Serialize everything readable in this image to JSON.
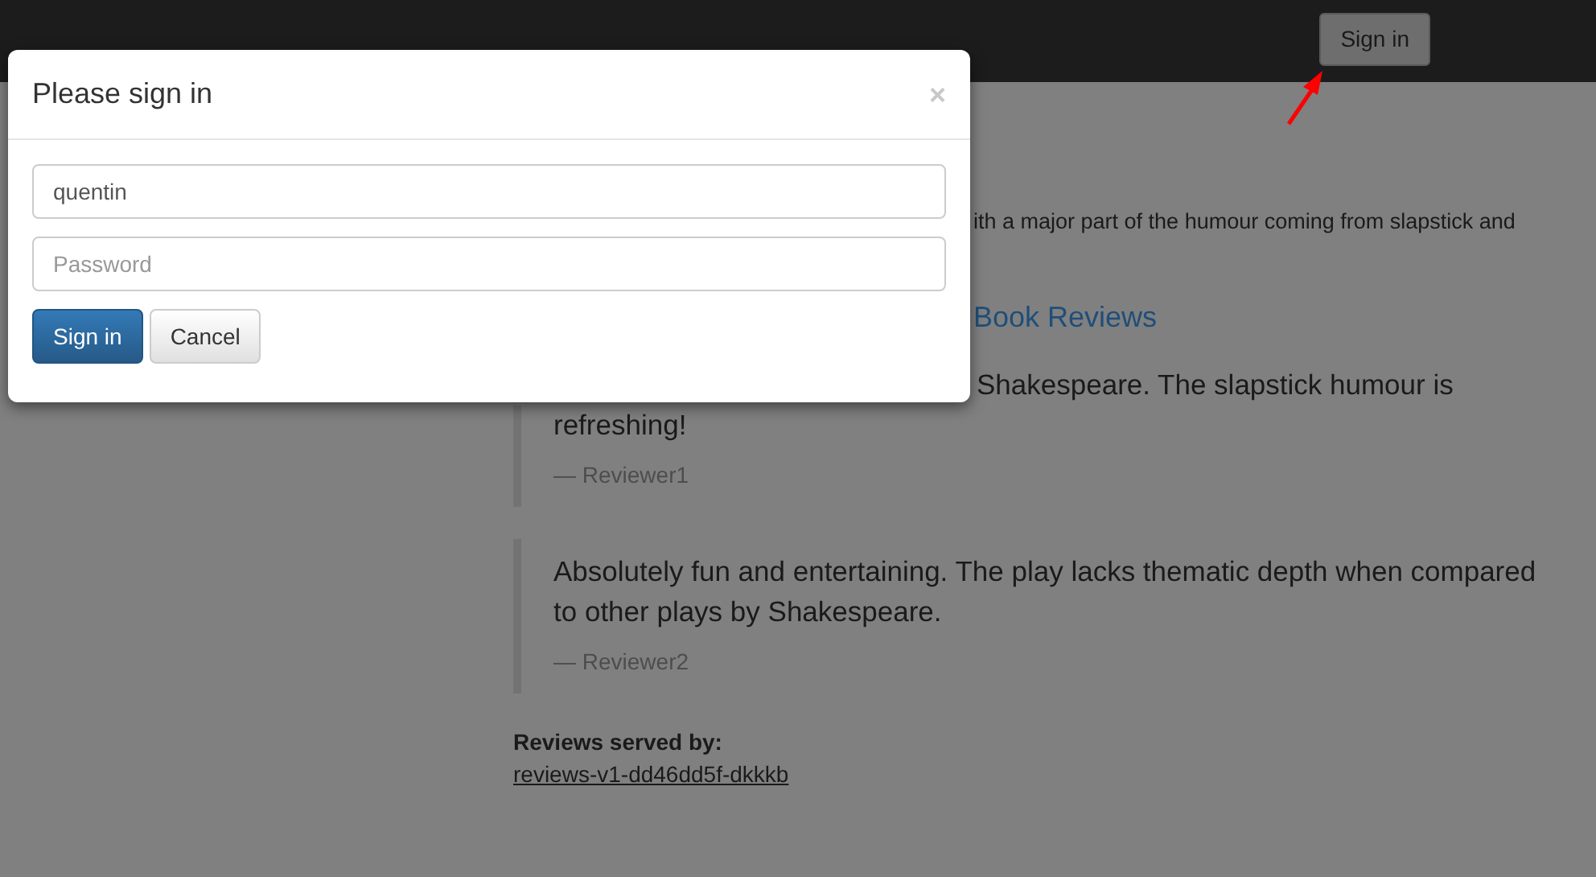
{
  "navbar": {
    "sign_in_button": "Sign in"
  },
  "background_page": {
    "description_fragment": "ith a major part of the humour coming from slapstick and",
    "reviews_heading_fragment": "Book Reviews",
    "reviews": [
      {
        "text_fragment": "Shakespeare. The slapstick humour is",
        "text": "refreshing!",
        "reviewer": "— Reviewer1"
      },
      {
        "text": "Absolutely fun and entertaining. The play lacks thematic depth when compared to other plays by Shakespeare.",
        "reviewer": "— Reviewer2"
      }
    ],
    "served_by": {
      "label": "Reviews served by:",
      "link": "reviews-v1-dd46dd5f-dkkkb"
    }
  },
  "modal": {
    "title": "Please sign in",
    "close": "×",
    "username": {
      "value": "quentin"
    },
    "password": {
      "placeholder": "Password"
    },
    "buttons": [
      {
        "label": "Sign in",
        "kind": "primary"
      },
      {
        "label": "Cancel",
        "kind": "default"
      }
    ]
  }
}
